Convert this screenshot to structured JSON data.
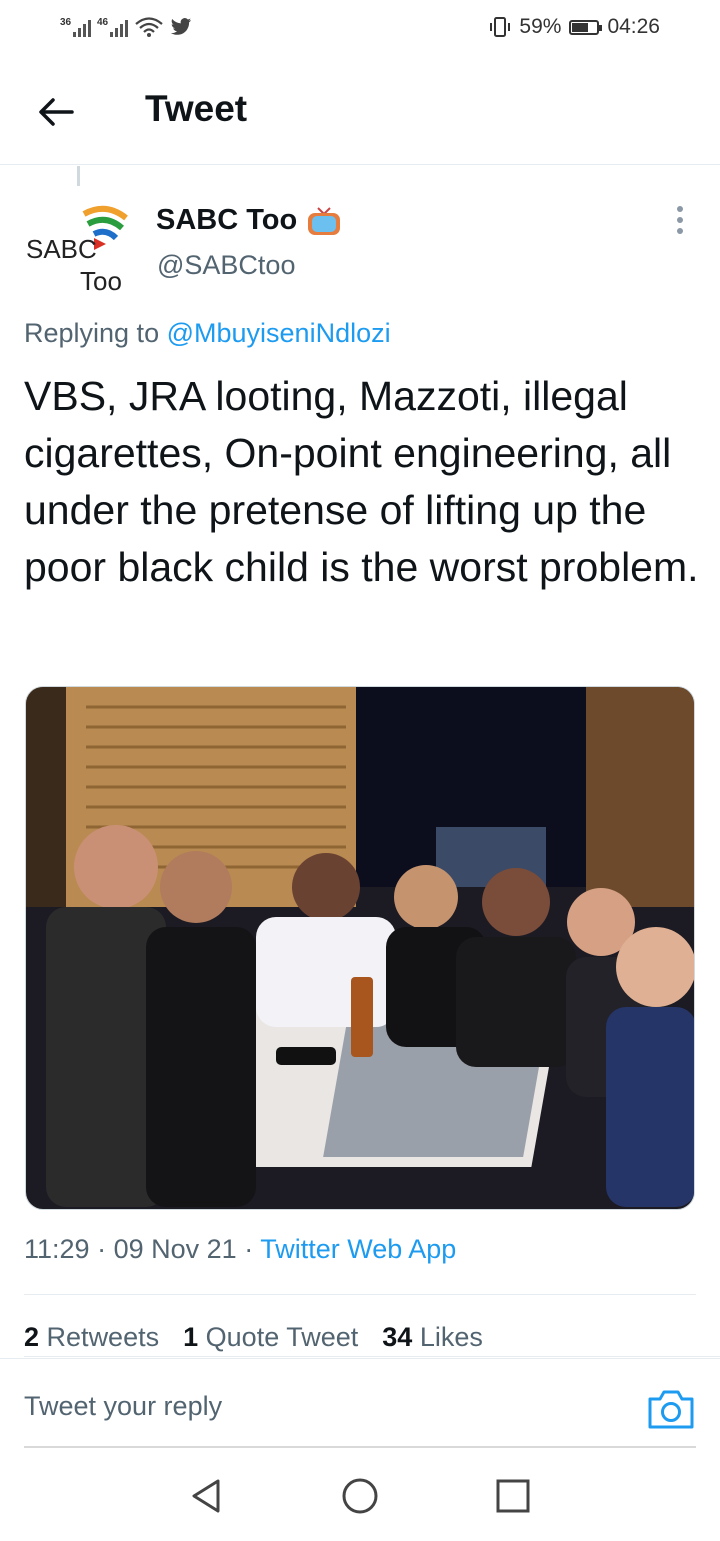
{
  "status_bar": {
    "sim1": "36",
    "sim2": "46",
    "battery_percent": "59%",
    "battery_level": 0.59,
    "time": "04:26"
  },
  "header": {
    "title": "Tweet"
  },
  "tweet": {
    "logo_text_top": "SABC",
    "logo_text_bottom": "Too",
    "display_name": "SABC Too",
    "handle": "@SABCtoo",
    "replying_prefix": "Replying to",
    "replying_to": "@MbuyiseniNdlozi",
    "text": "VBS, JRA looting, Mazzoti, illegal cigarettes, On-point engineering, all under the pretense of lifting up the poor black child is the worst problem.",
    "time": "11:29",
    "date": "09 Nov 21",
    "source": "Twitter Web App",
    "retweets_count": "2",
    "retweets_label": "Retweets",
    "quotes_count": "1",
    "quotes_label": "Quote Tweet",
    "likes_count": "34",
    "likes_label": "Likes"
  },
  "reply": {
    "placeholder": "Tweet your reply"
  },
  "colors": {
    "accent": "#1d9bf0",
    "secondary_text": "#536471",
    "primary_text": "#0f1419"
  }
}
